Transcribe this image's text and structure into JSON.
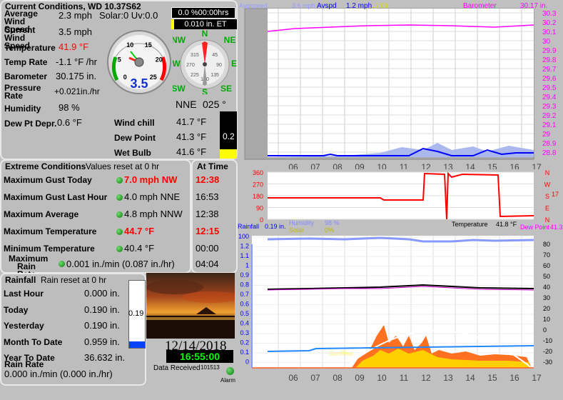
{
  "current": {
    "title": "Current Conditions, WD 10.37S62",
    "avg_wind_label": "Average Wind Speed",
    "avg_wind_value": "2.3 mph",
    "solar_uv": "Solar:0 Uv:0.0",
    "cur_wind_label": "Current Wind Speed",
    "cur_wind_value": "3.5 mph",
    "temp_label": "Temperature",
    "temp_value": "41.9 °F",
    "temp_rate_label": "Temp Rate",
    "temp_rate_value": "-1.1 °F /hr",
    "baro_label": "Barometer",
    "baro_value": "30.175 in.",
    "press_rate_label": "Pressure Rate",
    "press_rate_value": "+0.021in./hr",
    "humidity_label": "Humidity",
    "humidity_value": "98 %",
    "dewdep_label": "Dew Pt Depr.",
    "dewdep_value": "0.6 °F",
    "windchill_label": "Wind chill",
    "windchill_value": "41.7 °F",
    "dewpoint_label": "Dew Point",
    "dewpoint_value": "41.3 °F",
    "wetbulb_label": "Wet Bulb",
    "wetbulb_value": "41.6 °F",
    "dir_text": "NNE",
    "dir_deg": "025 °",
    "gauge_value": "3.5",
    "gauge_ticks": [
      "0",
      "5",
      "10",
      "15",
      "20",
      "25"
    ],
    "compass_labels": {
      "n": "N",
      "ne": "NE",
      "e": "E",
      "se": "SE",
      "s": "S",
      "sw": "SW",
      "w": "W",
      "nw": "NW"
    },
    "compass_degs": [
      "270",
      "315",
      "45",
      "90",
      "135",
      "225",
      "180"
    ],
    "evap_top": "0.0 %00:00hrs",
    "evap_et": "0.010 in. ET",
    "bar_value": "0.2",
    "bar_level": 0.2
  },
  "extremes": {
    "title": "Extreme Conditions",
    "reset_note": "Values reset at 0 hr",
    "at_time_title": "At Time",
    "rows": [
      {
        "label": "Maximum Gust Today",
        "value": "7.0 mph  NW",
        "time": "12:38",
        "red": true
      },
      {
        "label": "Maximum Gust Last Hour",
        "value": "4.0 mph NNE",
        "time": "16:53",
        "red": false
      },
      {
        "label": "Maximum Average",
        "value": "4.8 mph NNW",
        "time": "12:38",
        "red": false
      },
      {
        "label": "Maximum Temperature",
        "value": "44.7 °F",
        "time": "12:15",
        "red": true
      },
      {
        "label": "Minimum Temperature",
        "value": "40.4 °F",
        "time": "00:00",
        "red": false
      },
      {
        "label": "Maximum Rain Rate",
        "value": "0.001 in./min (0.087 in./hr)",
        "time": "04:04",
        "red": false
      }
    ]
  },
  "rainfall": {
    "title": "Rainfall",
    "reset_note": "Rain reset at 0 hr",
    "rows": [
      {
        "label": "Last Hour",
        "value": "0.000 in."
      },
      {
        "label": "Today",
        "value": "0.190 in."
      },
      {
        "label": "Yesterday",
        "value": "0.190 in."
      },
      {
        "label": "Month To Date",
        "value": "0.959 in."
      },
      {
        "label": "Year To Date",
        "value": "36.632 in."
      }
    ],
    "rate_label": "Rain Rate",
    "rate_value": "0.000 in./min (0.000 in./hr)",
    "bar_label": "0.19",
    "bar_level": 0.1
  },
  "status": {
    "date": "12/14/2018",
    "time": "16:55:00",
    "data_received_label": "Data Received",
    "data_received_count": "101513",
    "alarm_label": "Alarm"
  },
  "graphs": {
    "top": {
      "legend_left": "Avgspeed",
      "legend_spd": "3.6 mph",
      "legend_avspd": "Avspd",
      "legend_avspd_val": "1.2 mph",
      "legend_time": "17:00",
      "legend_baro": "Barometer",
      "legend_baro_val": "30.17 in.",
      "right_ticks": [
        "30.3",
        "30.2",
        "30.1",
        "30",
        "29.9",
        "29.8",
        "29.7",
        "29.6",
        "29.5",
        "29.4",
        "29.3",
        "29.2",
        "29.1",
        "29",
        "28.9",
        "28.8"
      ],
      "x_ticks": [
        "06",
        "07",
        "08",
        "09",
        "10",
        "11",
        "12",
        "13",
        "14",
        "15",
        "16",
        "17"
      ]
    },
    "mid": {
      "left_ticks": [
        "360",
        "270",
        "180",
        "90",
        "0"
      ],
      "right_letters": [
        "N",
        "W",
        "S",
        "E",
        "N"
      ],
      "right_num": "17",
      "temp_label": "Temperature",
      "temp_val": "41.8 °F",
      "dew_label": "Dew Point",
      "dew_val": "41.3"
    },
    "bot": {
      "legend_rain": "Rainfall",
      "legend_rain_val": "0.19 in.",
      "legend_hum": "Humidity",
      "legend_hum_val": "98 %",
      "legend_solar": "Solar",
      "legend_solar_val": "0%",
      "sunrise": "SunRise",
      "left_ticks": [
        "100",
        "1.2",
        "1.1",
        "1",
        "0.9",
        "0.8",
        "0.7",
        "0.6",
        "0.5",
        "0.4",
        "0.3",
        "0.2",
        "0.1",
        "0"
      ],
      "right_ticks": [
        "80",
        "70",
        "60",
        "50",
        "40",
        "30",
        "20",
        "10",
        "0",
        "-10",
        "-20",
        "-30"
      ],
      "x_ticks": [
        "06",
        "07",
        "08",
        "09",
        "10",
        "11",
        "12",
        "13",
        "14",
        "15",
        "16",
        "17"
      ]
    }
  },
  "colors": {
    "accent_blue": "#0000ff",
    "baro_magenta": "#ff00ff",
    "winddir_red": "#ff0000",
    "clock_green": "#00ff00"
  }
}
